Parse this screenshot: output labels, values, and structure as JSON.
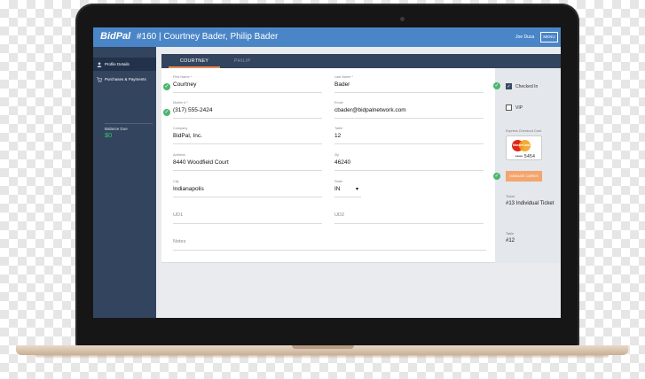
{
  "header": {
    "logo": "BidPal",
    "event_title": "#160 | Courtney Bader, Philip Bader",
    "user_name": "Joe Duca",
    "menu_label": "MENU"
  },
  "sidebar": {
    "items": [
      {
        "label": "Profile Details",
        "icon": "person-icon",
        "active": true
      },
      {
        "label": "Purchases & Payments",
        "icon": "cart-icon",
        "active": false
      }
    ],
    "balance_label": "Balance Due",
    "balance_value": "$0",
    "balance_color": "#39c46b"
  },
  "tabs": [
    {
      "label": "COURTNEY",
      "active": true
    },
    {
      "label": "PHILIP",
      "active": false
    }
  ],
  "form": {
    "first_name": {
      "label": "First Name *",
      "value": "Courtney"
    },
    "last_name": {
      "label": "Last Name *",
      "value": "Bader"
    },
    "mobile": {
      "label": "Mobile # *",
      "value": "(317) 555-2424"
    },
    "email": {
      "label": "Email",
      "value": "cbader@bidpalnetwork.com"
    },
    "company": {
      "label": "Company",
      "value": "BidPal, Inc."
    },
    "table": {
      "label": "Table",
      "value": "12"
    },
    "address": {
      "label": "Address",
      "value": "8440 Woodfield Court"
    },
    "zip": {
      "label": "Zip",
      "value": "46240"
    },
    "city": {
      "label": "City",
      "value": "Indianapolis"
    },
    "state": {
      "label": "State",
      "value": "IN"
    },
    "ud1": {
      "placeholder": "UD1"
    },
    "ud2": {
      "placeholder": "UD2"
    },
    "notes": {
      "placeholder": "Notes"
    }
  },
  "right_panel": {
    "checked_in_label": "Checked In",
    "checked_in": true,
    "vip_label": "VIP",
    "vip": false,
    "express_checkout_label": "Express Checkout Card",
    "card_brand": "MasterCard",
    "card_last4": "•••• 5454",
    "manage_cards_label": "MANAGE CARDS",
    "ticket_label": "Ticket",
    "ticket_value": "#13 Individual Ticket",
    "table_label": "Table",
    "table_value": "#12"
  },
  "colors": {
    "header_bg": "#4a86c7",
    "sidebar_bg": "#33445e",
    "tab_accent": "#ef8a52",
    "check_green": "#4bb56f",
    "button_orange": "#f4a56d"
  }
}
